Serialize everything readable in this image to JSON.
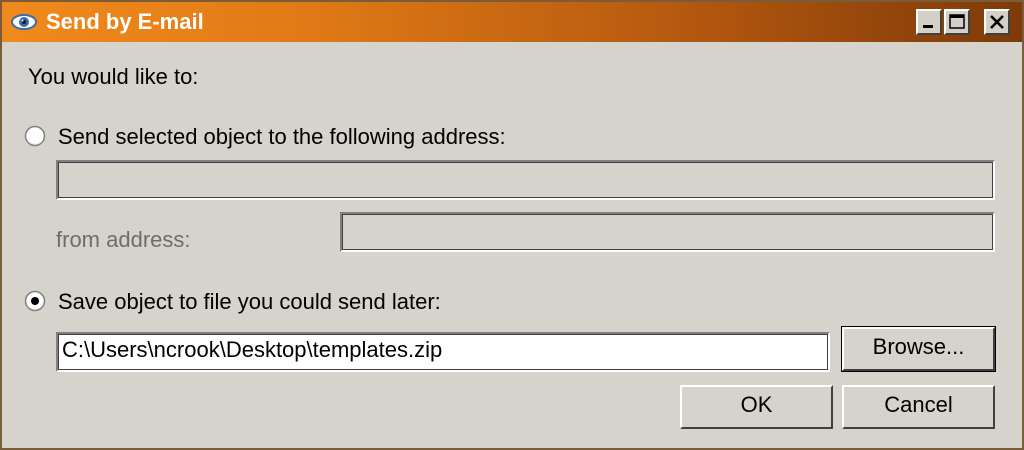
{
  "window": {
    "title": "Send by E-mail",
    "accent_color": "#f08a1c",
    "icon": "eye-icon"
  },
  "form": {
    "prompt": "You would like to:",
    "option_send": {
      "label": "Send selected object to the following address:",
      "selected": false,
      "address_value": "",
      "from_label": "from address:",
      "from_value": ""
    },
    "option_save": {
      "label": "Save object to file you could send later:",
      "selected": true,
      "path_value": "C:\\Users\\ncrook\\Desktop\\templates.zip",
      "browse_label": "Browse..."
    }
  },
  "buttons": {
    "ok_label": "OK",
    "cancel_label": "Cancel"
  }
}
